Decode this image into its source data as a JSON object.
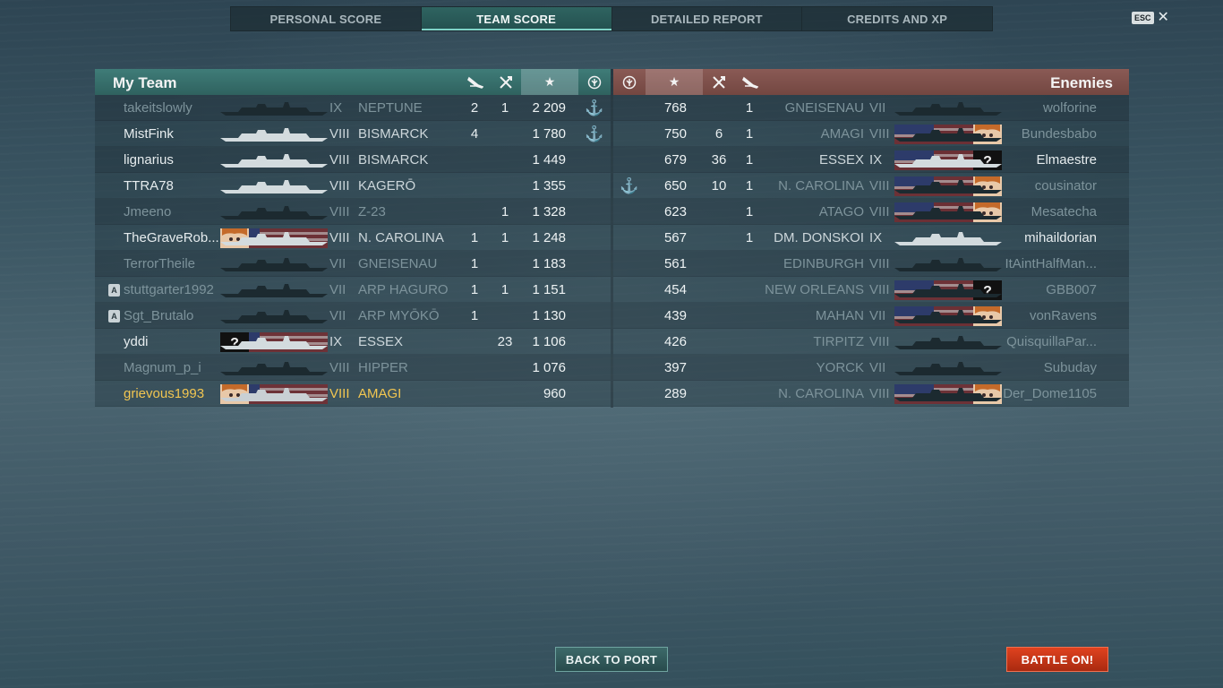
{
  "tabs": [
    "PERSONAL SCORE",
    "TEAM SCORE",
    "DETAILED REPORT",
    "CREDITS AND XP"
  ],
  "active_tab": 1,
  "esc": {
    "key": "ESC",
    "close": "✕"
  },
  "my_team": {
    "title": "My Team",
    "rows": [
      {
        "player": "takeitslowly",
        "tier": "IX",
        "ship": "NEPTUNE",
        "planes": "2",
        "frags": "1",
        "score": "2 209",
        "anchor": true,
        "state": "dim",
        "division": "",
        "flag": "none"
      },
      {
        "player": "MistFink",
        "tier": "VIII",
        "ship": "BISMARCK",
        "planes": "4",
        "frags": "",
        "score": "1 780",
        "anchor": true,
        "state": "normal",
        "division": "",
        "flag": "none"
      },
      {
        "player": "lignarius",
        "tier": "VIII",
        "ship": "BISMARCK",
        "planes": "",
        "frags": "",
        "score": "1 449",
        "anchor": false,
        "state": "normal",
        "division": "",
        "flag": "none"
      },
      {
        "player": "TTRA78",
        "tier": "VIII",
        "ship": "KAGERŌ",
        "planes": "",
        "frags": "",
        "score": "1 355",
        "anchor": false,
        "state": "normal",
        "division": "",
        "flag": "none"
      },
      {
        "player": "Jmeeno",
        "tier": "VIII",
        "ship": "Z-23",
        "planes": "",
        "frags": "1",
        "score": "1 328",
        "anchor": false,
        "state": "dim",
        "division": "",
        "flag": "none"
      },
      {
        "player": "TheGraveRob...",
        "tier": "VIII",
        "ship": "N. CAROLINA",
        "planes": "1",
        "frags": "1",
        "score": "1 248",
        "anchor": false,
        "state": "normal",
        "division": "",
        "flag": "portrait"
      },
      {
        "player": "TerrorTheile",
        "tier": "VII",
        "ship": "GNEISENAU",
        "planes": "1",
        "frags": "",
        "score": "1 183",
        "anchor": false,
        "state": "dim",
        "division": "",
        "flag": "none"
      },
      {
        "player": "stuttgarter1992",
        "tier": "VII",
        "ship": "ARP HAGURO",
        "planes": "1",
        "frags": "1",
        "score": "1 151",
        "anchor": false,
        "state": "dim",
        "division": "A",
        "flag": "none"
      },
      {
        "player": "Sgt_Brutalo",
        "tier": "VII",
        "ship": "ARP MYŌKŌ",
        "planes": "1",
        "frags": "",
        "score": "1 130",
        "anchor": false,
        "state": "dim",
        "division": "A",
        "flag": "none"
      },
      {
        "player": "yddi",
        "tier": "IX",
        "ship": "ESSEX",
        "planes": "",
        "frags": "23",
        "score": "1 106",
        "anchor": false,
        "state": "normal",
        "division": "",
        "flag": "mystery"
      },
      {
        "player": "Magnum_p_i",
        "tier": "VIII",
        "ship": "HIPPER",
        "planes": "",
        "frags": "",
        "score": "1 076",
        "anchor": false,
        "state": "dim",
        "division": "",
        "flag": "none"
      },
      {
        "player": "grievous1993",
        "tier": "VIII",
        "ship": "AMAGI",
        "planes": "",
        "frags": "",
        "score": "960",
        "anchor": false,
        "state": "me",
        "division": "",
        "flag": "portrait"
      }
    ]
  },
  "enemies": {
    "title": "Enemies",
    "rows": [
      {
        "player": "wolforine",
        "tier": "VII",
        "ship": "GNEISENAU",
        "planes": "1",
        "frags": "",
        "score": "768",
        "anchor": false,
        "state": "dim",
        "flag": "none"
      },
      {
        "player": "Bundesbabo",
        "tier": "VIII",
        "ship": "AMAGI",
        "planes": "1",
        "frags": "6",
        "score": "750",
        "anchor": false,
        "state": "dim",
        "flag": "portrait"
      },
      {
        "player": "Elmaestre",
        "tier": "IX",
        "ship": "ESSEX",
        "planes": "1",
        "frags": "36",
        "score": "679",
        "anchor": false,
        "state": "normal",
        "flag": "mystery"
      },
      {
        "player": "cousinator",
        "tier": "VIII",
        "ship": "N. CAROLINA",
        "planes": "1",
        "frags": "10",
        "score": "650",
        "anchor": true,
        "state": "dim",
        "flag": "portrait"
      },
      {
        "player": "Mesatecha",
        "tier": "VIII",
        "ship": "ATAGO",
        "planes": "1",
        "frags": "",
        "score": "623",
        "anchor": false,
        "state": "dim",
        "flag": "portrait"
      },
      {
        "player": "mihaildorian",
        "tier": "IX",
        "ship": "DM. DONSKOI",
        "planes": "1",
        "frags": "",
        "score": "567",
        "anchor": false,
        "state": "normal",
        "flag": "none"
      },
      {
        "player": "ItAintHalfMan...",
        "tier": "VIII",
        "ship": "EDINBURGH",
        "planes": "",
        "frags": "",
        "score": "561",
        "anchor": false,
        "state": "dim",
        "flag": "none"
      },
      {
        "player": "GBB007",
        "tier": "VIII",
        "ship": "NEW ORLEANS",
        "planes": "",
        "frags": "",
        "score": "454",
        "anchor": false,
        "state": "dim",
        "flag": "mystery"
      },
      {
        "player": "vonRavens",
        "tier": "VII",
        "ship": "MAHAN",
        "planes": "",
        "frags": "",
        "score": "439",
        "anchor": false,
        "state": "dim",
        "flag": "portrait"
      },
      {
        "player": "QuisquillaPar...",
        "tier": "VIII",
        "ship": "TIRPITZ",
        "planes": "",
        "frags": "",
        "score": "426",
        "anchor": false,
        "state": "dim",
        "flag": "none"
      },
      {
        "player": "Subuday",
        "tier": "VII",
        "ship": "YORCK",
        "planes": "",
        "frags": "",
        "score": "397",
        "anchor": false,
        "state": "dim",
        "flag": "none"
      },
      {
        "player": "Der_Dome1105",
        "tier": "VIII",
        "ship": "N. CAROLINA",
        "planes": "",
        "frags": "",
        "score": "289",
        "anchor": false,
        "state": "dim",
        "flag": "portrait"
      }
    ]
  },
  "header_icons": {
    "planes": "plane-icon",
    "frags": "kill-icon",
    "score": "★",
    "rank": "rank-icon"
  },
  "buttons": {
    "back": "BACK TO PORT",
    "battle": "BATTLE ON!"
  },
  "colors": {
    "my_team_header": "#3f7c78",
    "enemy_header": "#8a5a55",
    "self_highlight": "#f2c651",
    "anchor": "#d9b24c",
    "battle_button": "#e0421f"
  }
}
